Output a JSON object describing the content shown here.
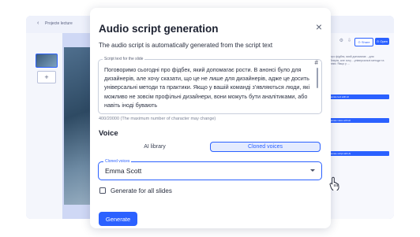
{
  "background": {
    "back_arrow": "‹",
    "project_title": "Projecte lecture",
    "add_slide": "+",
    "icon_a": "⚙",
    "icon_b": "⇩",
    "share_label": "⊙ Share",
    "open_label": "⊙ Open",
    "side_text": "...та про фідбек, який допомагає ...для дизайнерів, але хочу ...універсальні методи та практики. Якщо у ...",
    "generate_text_ai": "Generate text with AI",
    "generate_voice_ai": "Generate voice with AI",
    "generate_script_ai": "Generate script with AI"
  },
  "modal": {
    "title": "Audio script generation",
    "close": "×",
    "subtitle": "The audio script is automatically generated from the script text",
    "script_label": "Script text for the slide",
    "script_text": "Поговоримо сьогодні про фідбек, який допомагає рости. В анонсі було для дизайнерів, але хочу сказати, що це не лише для дизайнерів, адже це досить універсальні методи та практики. Якщо у вашій команді з’являються люди, які можливо не зовсім профільні дизайнери, вони можуть бути аналітиками, або навіть іноді бувають",
    "script_hash": "#",
    "char_count": "400/20000 (The maximum number of character may change)",
    "voice_title": "Voice",
    "tabs": [
      {
        "label": "AI library",
        "active": false
      },
      {
        "label": "Cloned voices",
        "active": true
      }
    ],
    "cloned_voices_label": "Cloned voices",
    "selected_voice": "Emma Scott",
    "generate_all_label": "Generate for all slides",
    "generate_all_checked": false,
    "generate_button": "Generate"
  },
  "colors": {
    "accent": "#2b61ff",
    "tab_active_bg": "#e4ebff",
    "backdrop": "#cfd8f5"
  }
}
